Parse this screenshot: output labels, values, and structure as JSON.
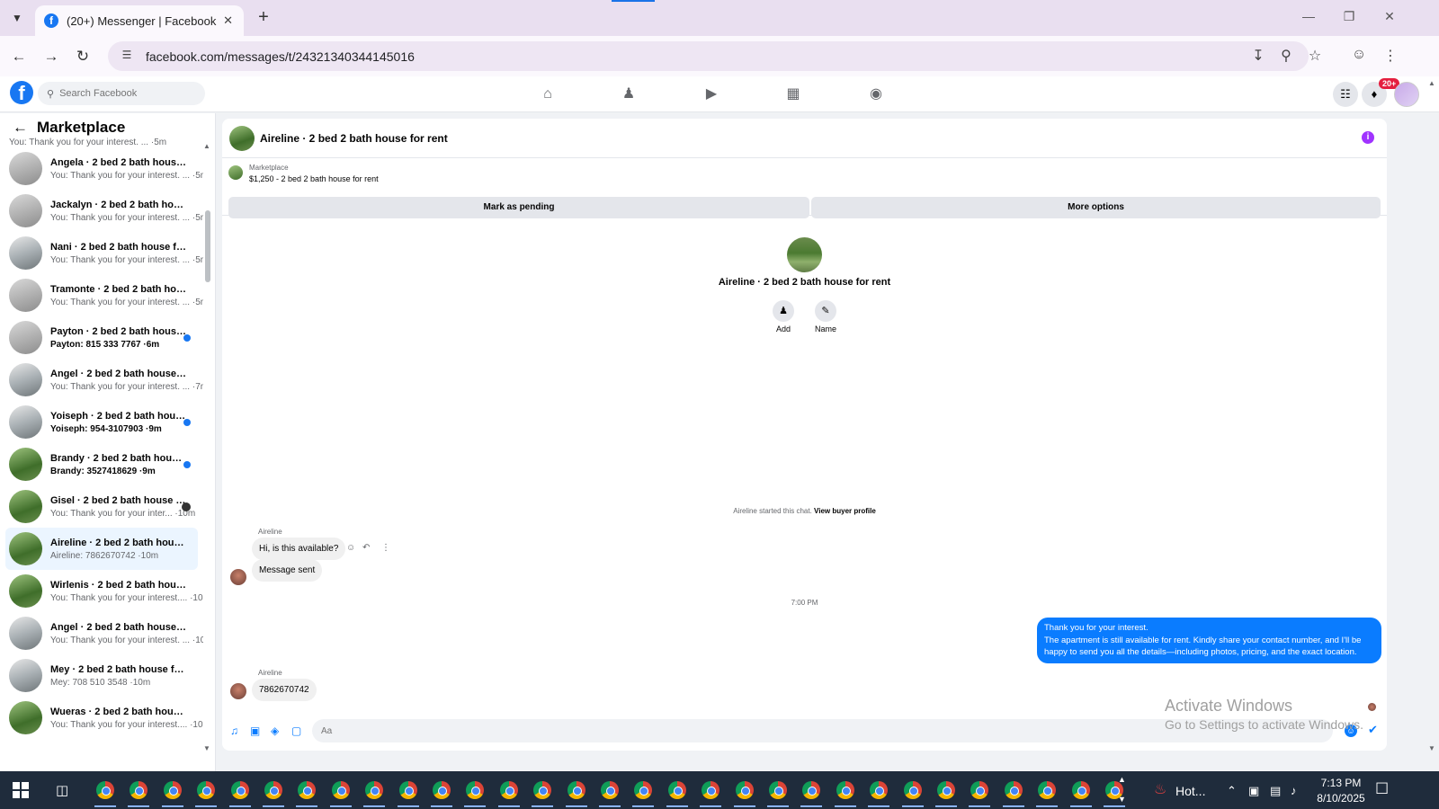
{
  "browser": {
    "tab_title": "(20+) Messenger | Facebook",
    "url": "facebook.com/messages/t/24321340344145016"
  },
  "fb": {
    "search_placeholder": "Search Facebook",
    "notification_badge": "20+"
  },
  "sidebar": {
    "title": "Marketplace",
    "conversations": [
      {
        "name": "",
        "sub": "You: Thank you for your interest. ... ·5m",
        "partial": true
      },
      {
        "name": "Angela · 2 bed 2 bath house fo...",
        "sub": "You: Thank you for your interest. ... ·5m"
      },
      {
        "name": "Jackalyn · 2 bed 2 bath house f...",
        "sub": "You: Thank you for your interest. ... ·5m"
      },
      {
        "name": "Nani · 2 bed 2 bath house for r...",
        "sub": "You: Thank you for your interest. ... ·5m"
      },
      {
        "name": "Tramonte · 2 bed 2 bath house ...",
        "sub": "You: Thank you for your interest. ... ·5m"
      },
      {
        "name": "Payton · 2 bed 2 bath house f...",
        "sub": "Payton: 815 333 7767 ·6m",
        "unread": true
      },
      {
        "name": "Angel · 2 bed 2 bath house for ...",
        "sub": "You: Thank you for your interest. ... ·7m"
      },
      {
        "name": "Yoiseph · 2 bed 2 bath house ...",
        "sub": "Yoiseph: 954-3107903 ·9m",
        "unread": true
      },
      {
        "name": "Brandy · 2 bed 2 bath house f...",
        "sub": "Brandy: 3527418629 ·9m",
        "unread": true
      },
      {
        "name": "Gisel · 2 bed 2 bath house fo...",
        "sub": "You: Thank you for your inter... ·10m",
        "seen": true
      },
      {
        "name": "Aireline · 2 bed 2 bath house fo...",
        "sub": "Aireline: 7862670742 ·10m",
        "active": true
      },
      {
        "name": "Wirlenis · 2 bed 2 bath house f...",
        "sub": "You: Thank you for your interest.... ·10m"
      },
      {
        "name": "Angel · 2 bed 2 bath house for ...",
        "sub": "You: Thank you for your interest. ... ·10m"
      },
      {
        "name": "Mey · 2 bed 2 bath house for r...",
        "sub": "Mey: 708 510 3548 ·10m"
      },
      {
        "name": "Wueras · 2 bed 2 bath house fo...",
        "sub": "You: Thank you for your interest.... ·10m"
      }
    ]
  },
  "chat": {
    "title": "Aireline · 2 bed 2 bath house for rent",
    "listing_label": "Marketplace",
    "listing_price": "$1,250 - 2 bed 2 bath house for rent",
    "mark_pending": "Mark as pending",
    "more_options": "More options",
    "center_name": "Aireline · 2 bed 2 bath house for rent",
    "add_label": "Add",
    "name_label": "Name",
    "started_text": "Aireline started this chat. ",
    "view_profile": "View buyer profile",
    "sender1": "Aireline",
    "msg1": "Hi, is this available?",
    "msg2": "Message sent",
    "time": "7:00 PM",
    "out_line1": "Thank you for your interest.",
    "out_line2": "The apartment is still available for rent. Kindly share your contact number, and I'll be happy to send you all the details—including photos, pricing, and the exact location.",
    "sender2": "Aireline",
    "msg3": "7862670742",
    "composer_placeholder": "Aa"
  },
  "watermark": {
    "line1": "Activate Windows",
    "line2": "Go to Settings to activate Windows."
  },
  "taskbar": {
    "weather": "Hot...",
    "time": "7:13 PM",
    "date": "8/10/2025"
  }
}
